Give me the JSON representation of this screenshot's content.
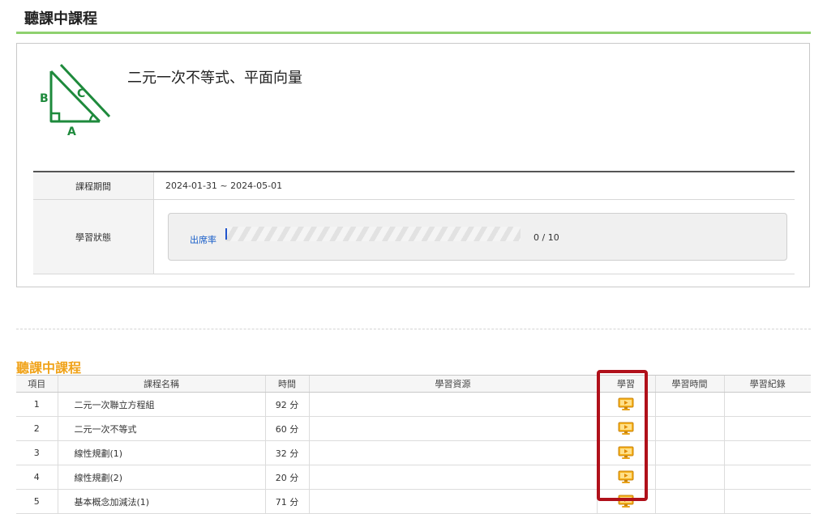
{
  "header": {
    "title": "聽課中課程"
  },
  "course": {
    "name": "二元一次不等式、平面向量",
    "logo_letters": {
      "a": "A",
      "b": "B",
      "c": "C"
    },
    "period_label": "課程期間",
    "period_value": "2024-01-31 ~ 2024-05-01",
    "status_label": "學習狀態",
    "attendance_label": "出席率",
    "attendance_value": "0 / 10",
    "attendance_completed": 0,
    "attendance_total": 10
  },
  "lessons": {
    "title": "聽課中課程",
    "columns": [
      "項目",
      "課程名稱",
      "時間",
      "學習資源",
      "學習",
      "學習時間",
      "學習紀錄"
    ],
    "rows": [
      {
        "num": "1",
        "name": "二元一次聯立方程組",
        "time": "92 分"
      },
      {
        "num": "2",
        "name": "二元一次不等式",
        "time": "60 分"
      },
      {
        "num": "3",
        "name": "線性規劃(1)",
        "time": "32 分"
      },
      {
        "num": "4",
        "name": "線性規劃(2)",
        "time": "20 分"
      },
      {
        "num": "5",
        "name": "基本概念加減法(1)",
        "time": "71 分"
      }
    ]
  },
  "colors": {
    "accent_green": "#8fd16f",
    "logo_green": "#1e8a3c",
    "section_orange": "#f0a31a",
    "highlight_red": "#b0101a",
    "link_blue": "#1a5fc9"
  },
  "icons": {
    "study": "monitor-play-icon"
  }
}
